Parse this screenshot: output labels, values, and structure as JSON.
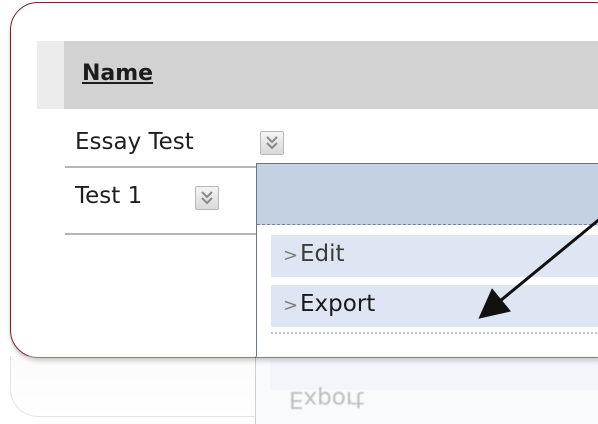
{
  "table": {
    "header": {
      "name_label": "Name"
    },
    "rows": [
      {
        "label": "Essay Test"
      },
      {
        "label": "Test 1"
      }
    ]
  },
  "dropdown": {
    "items": [
      {
        "prefix": ">",
        "label": "Edit"
      },
      {
        "prefix": ">",
        "label": "Export"
      }
    ],
    "reflection_label": "Export"
  },
  "colors": {
    "card_border": "#7e1f24",
    "header_bar": "#d2d2d2",
    "menu_header": "#c3d1e2",
    "menu_item": "#dde6f2",
    "arrow": "#111111"
  },
  "icons": {
    "row_menu": "chevron-down-icon",
    "menu_item_marker": "chevron-right-icon",
    "annotation": "arrow-icon"
  }
}
